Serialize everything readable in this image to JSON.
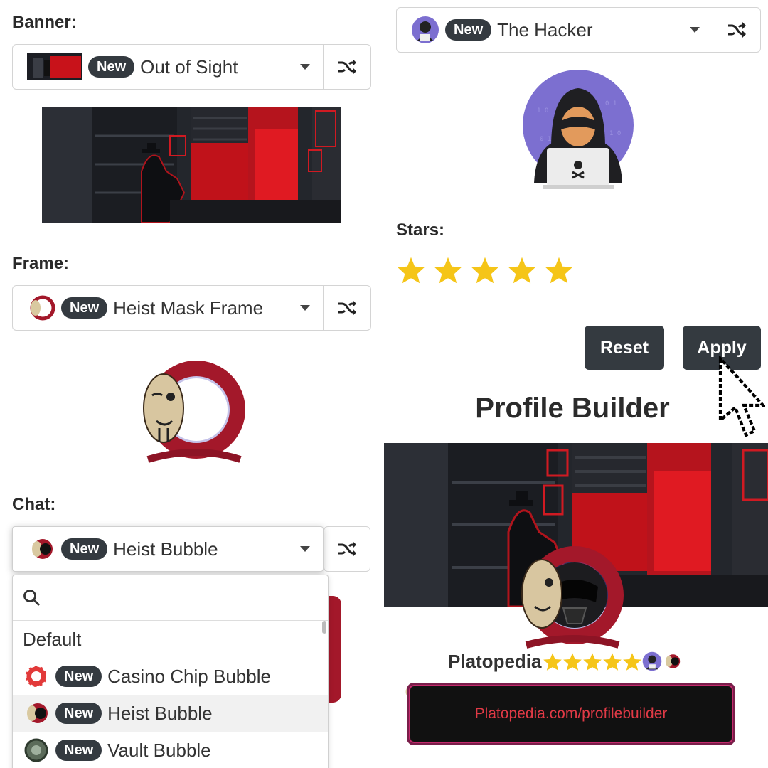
{
  "banner": {
    "label": "Banner:",
    "badge": "New",
    "selected": "Out of Sight",
    "icon": "shuffle-icon"
  },
  "avatar": {
    "badge": "New",
    "selected": "The Hacker",
    "icon": "shuffle-icon"
  },
  "frame": {
    "label": "Frame:",
    "badge": "New",
    "selected": "Heist Mask Frame",
    "icon": "shuffle-icon"
  },
  "stars": {
    "label": "Stars:",
    "count": 5,
    "color": "#f5c518"
  },
  "chat": {
    "label": "Chat:",
    "badge": "New",
    "selected": "Heist Bubble",
    "icon": "shuffle-icon"
  },
  "dropdown": {
    "search_icon": "search-icon",
    "options": [
      {
        "badge": "",
        "label": "Default"
      },
      {
        "badge": "New",
        "label": "Casino Chip Bubble"
      },
      {
        "badge": "New",
        "label": "Heist Bubble",
        "highlighted": true
      },
      {
        "badge": "New",
        "label": "Vault Bubble"
      }
    ]
  },
  "buttons": {
    "reset": "Reset",
    "apply": "Apply"
  },
  "preview": {
    "title": "Profile Builder",
    "username": "Platopedia",
    "chat_text": "Platopedia.com/profilebuilder"
  },
  "colors": {
    "button_bg": "#343a40",
    "badge_bg": "#343a40",
    "banner_red": "#d8141a",
    "hood_red": "#a3182a",
    "avatar_purple": "#7c6fd0"
  }
}
